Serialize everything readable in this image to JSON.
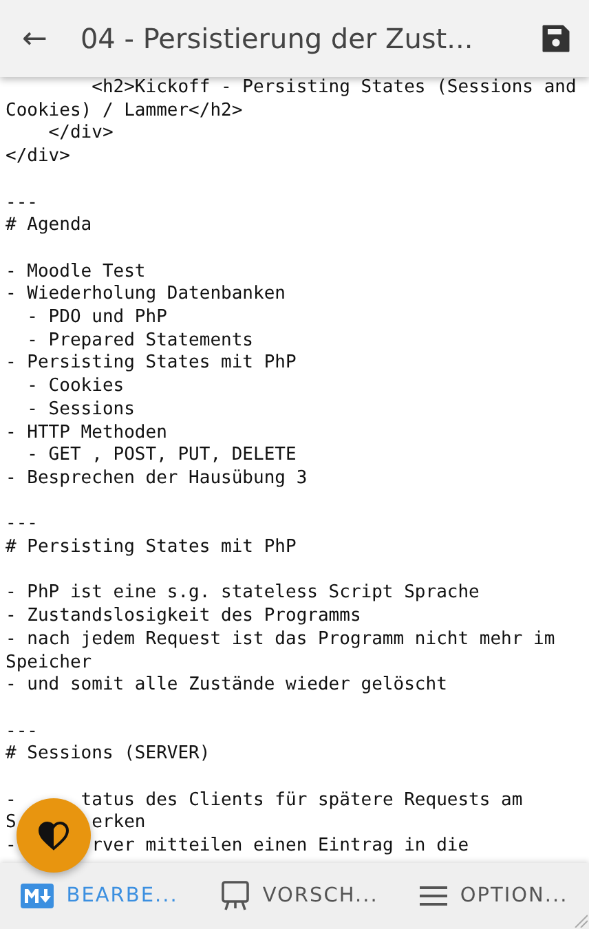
{
  "header": {
    "back_icon": "←",
    "title": "04 - Persistierung der Zust..."
  },
  "editor": {
    "blocks": [
      [
        "        <h2>Kickoff - Persisting States (Sessions and",
        "Cookies) / Lammer</h2>",
        "    </div>",
        "</div>"
      ],
      [
        "---",
        "# Agenda"
      ],
      [
        "- Moodle Test",
        "- Wiederholung Datenbanken",
        "  - PDO und PhP",
        "  - Prepared Statements",
        "- Persisting States mit PhP",
        "  - Cookies",
        "  - Sessions",
        "- HTTP Methoden",
        "  - GET , POST, PUT, DELETE",
        "- Besprechen der Hausübung 3"
      ],
      [
        "---",
        "# Persisting States mit PhP"
      ],
      [
        "- PhP ist eine s.g. stateless Script Sprache",
        "- Zustandslosigkeit des Programms",
        "- nach jedem Request ist das Programm nicht mehr im",
        "Speicher",
        "- und somit alle Zustände wieder gelöscht"
      ],
      [
        "---",
        "# Sessions (SERVER)"
      ],
      [
        [
          "-",
          "      tatus des Clients für spätere Requests am"
        ],
        [
          "S",
          "       erken"
        ],
        [
          "-",
          "       rver mitteilen einen Eintrag in die"
        ]
      ]
    ]
  },
  "tabs": [
    {
      "kind": "markdown",
      "label": "BEARBE...",
      "selected": true
    },
    {
      "kind": "preview",
      "label": "VORSCH...",
      "selected": false
    },
    {
      "kind": "options",
      "label": "OPTION...",
      "selected": false
    }
  ]
}
